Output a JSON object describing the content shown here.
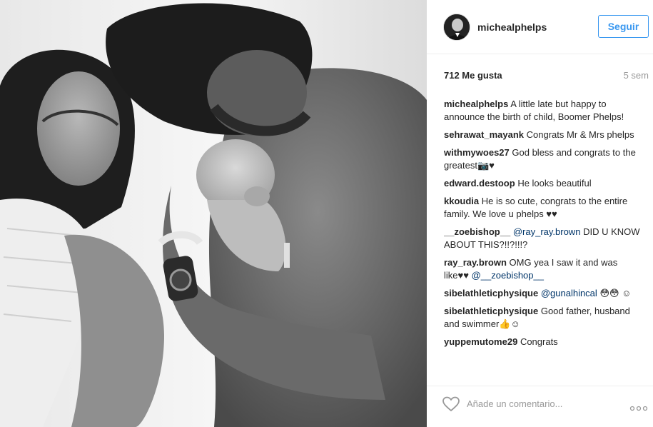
{
  "post": {
    "image_alt": "",
    "author": {
      "username": "michealphelps",
      "follow_label": "Seguir"
    },
    "likes": "712 Me gusta",
    "time_ago": "5 sem",
    "comments": [
      {
        "user": "michealphelps",
        "text": "A little late but happy to announce the birth of child, Boomer Phelps!"
      },
      {
        "user": "sehrawat_mayank",
        "text": "Congrats Mr & Mrs phelps"
      },
      {
        "user": "withmywoes27",
        "text": "God bless and congrats to the greatest📷♥"
      },
      {
        "user": "edward.destoop",
        "text": "He looks beautiful"
      },
      {
        "user": "kkoudia",
        "text": "He is so cute, congrats to the entire family. We love u phelps ♥♥"
      },
      {
        "user": "__zoebishop__",
        "mention": "@ray_ray.brown",
        "text": "DID U KNOW ABOUT THIS?!!?!!!?"
      },
      {
        "user": "ray_ray.brown",
        "text": "OMG yea I saw it and was like♥♥",
        "mention_after": "@__zoebishop__"
      },
      {
        "user": "sibelathleticphysique",
        "mention": "@gunalhincal",
        "text": "😳😳 ☺"
      },
      {
        "user": "sibelathleticphysique",
        "text": "Good father, husband and swimmer👍☺"
      },
      {
        "user": "yuppemutome29",
        "text": "Congrats"
      }
    ],
    "comment_placeholder": "Añade un comentario..."
  },
  "icons": {
    "like": "heart-outline-icon",
    "more": "more-dots-icon"
  }
}
